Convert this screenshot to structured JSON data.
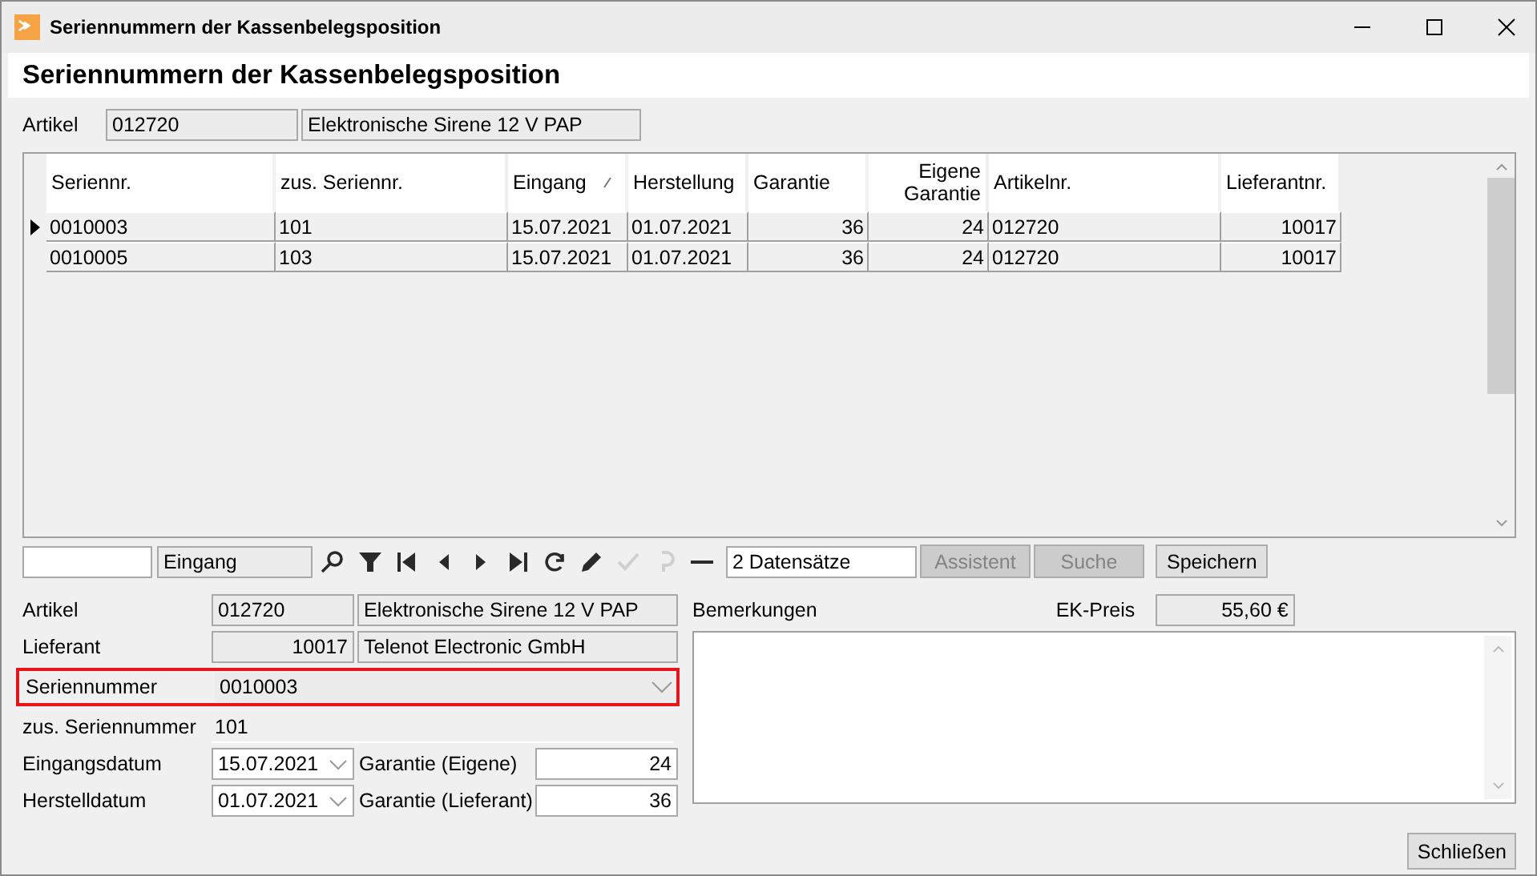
{
  "window": {
    "title": "Seriennummern der Kassenbelegsposition"
  },
  "header": {
    "title": "Seriennummern der Kassenbelegsposition"
  },
  "article": {
    "label": "Artikel",
    "number": "012720",
    "name": "Elektronische Sirene 12 V PAP"
  },
  "table": {
    "columns": [
      {
        "label": "Seriennr.",
        "numeric": false,
        "sorted": false
      },
      {
        "label": "zus. Seriennr.",
        "numeric": false,
        "sorted": false
      },
      {
        "label": "Eingang",
        "numeric": false,
        "sorted": true
      },
      {
        "label": "Herstellung",
        "numeric": false,
        "sorted": false
      },
      {
        "label": "Garantie",
        "numeric": true,
        "sorted": false
      },
      {
        "label": "Eigene Garantie",
        "numeric": true,
        "sorted": false
      },
      {
        "label": "Artikelnr.",
        "numeric": false,
        "sorted": false
      },
      {
        "label": "Lieferantnr.",
        "numeric": true,
        "sorted": false
      }
    ],
    "rows": [
      {
        "selected": true,
        "cells": [
          "0010003",
          "101",
          "15.07.2021",
          "01.07.2021",
          "36",
          "24",
          "012720",
          "10017"
        ]
      },
      {
        "selected": false,
        "cells": [
          "0010005",
          "103",
          "15.07.2021",
          "01.07.2021",
          "36",
          "24",
          "012720",
          "10017"
        ]
      }
    ]
  },
  "navigator": {
    "sort_field": "Eingang",
    "tools": [
      {
        "kind": "search",
        "disabled": false
      },
      {
        "kind": "filter",
        "disabled": false
      },
      {
        "kind": "first",
        "disabled": false
      },
      {
        "kind": "prev",
        "disabled": false
      },
      {
        "kind": "next",
        "disabled": false
      },
      {
        "kind": "last",
        "disabled": false
      },
      {
        "kind": "refresh",
        "disabled": false
      },
      {
        "kind": "edit",
        "disabled": false
      },
      {
        "kind": "confirm",
        "disabled": true
      },
      {
        "kind": "undo",
        "disabled": true
      },
      {
        "kind": "delete",
        "disabled": false
      }
    ],
    "record_count": "2 Datensätze",
    "buttons": [
      {
        "label": "Assistent",
        "disabled": true
      },
      {
        "label": "Suche",
        "disabled": true
      },
      {
        "label": "Speichern",
        "disabled": false
      }
    ]
  },
  "form": {
    "article": {
      "label": "Artikel",
      "number": "012720",
      "name": "Elektronische Sirene 12 V PAP"
    },
    "supplier": {
      "label": "Lieferant",
      "number": "10017",
      "name": "Telenot Electronic GmbH"
    },
    "serial": {
      "label": "Seriennummer",
      "value": "0010003",
      "highlighted": true
    },
    "extra_serial": {
      "label": "zus. Seriennummer",
      "value": "101"
    },
    "receipt_date": {
      "label": "Eingangsdatum",
      "value": "15.07.2021"
    },
    "warranty_own": {
      "label": "Garantie (Eigene)",
      "value": "24"
    },
    "production_date": {
      "label": "Herstelldatum",
      "value": "01.07.2021"
    },
    "warranty_supplier": {
      "label": "Garantie (Lieferant)",
      "value": "36"
    }
  },
  "remarks": {
    "label": "Bemerkungen"
  },
  "price": {
    "label": "EK-Preis",
    "value": "55,60 €"
  },
  "close_button": {
    "label": "Schließen"
  }
}
